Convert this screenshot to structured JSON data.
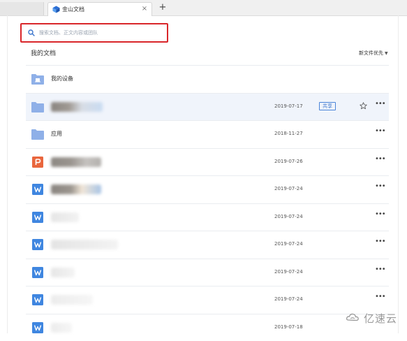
{
  "browser": {
    "tab_title": "金山文档",
    "close_glyph": "×",
    "new_tab_glyph": "+"
  },
  "search": {
    "placeholder": "搜索文档、正文内容或团队",
    "value": "",
    "icon": "search-icon"
  },
  "section": {
    "title": "我的文档",
    "sort_label": "新文件优先",
    "sort_caret": "▼"
  },
  "rows": [
    {
      "type": "device-folder",
      "name": "我的设备",
      "date": "",
      "shared": false,
      "star": false,
      "more": false
    },
    {
      "type": "folder",
      "name": "",
      "date": "2019-07-17",
      "shared": true,
      "share_label": "共享",
      "star": true,
      "more": true
    },
    {
      "type": "folder",
      "name": "应用",
      "date": "2018-11-27",
      "shared": false,
      "star": false,
      "more": true
    },
    {
      "type": "ppt",
      "name": "",
      "date": "2019-07-26",
      "shared": false,
      "star": false,
      "more": true
    },
    {
      "type": "word",
      "name": "",
      "date": "2019-07-24",
      "shared": false,
      "star": false,
      "more": true
    },
    {
      "type": "word",
      "name": "",
      "date": "2019-07-24",
      "shared": false,
      "star": false,
      "more": true
    },
    {
      "type": "word",
      "name": "",
      "date": "2019-07-24",
      "shared": false,
      "star": false,
      "more": true
    },
    {
      "type": "word",
      "name": "",
      "date": "2019-07-24",
      "shared": false,
      "star": false,
      "more": true
    },
    {
      "type": "word",
      "name": "",
      "date": "2019-07-24",
      "shared": false,
      "star": false,
      "more": true
    },
    {
      "type": "word",
      "name": "",
      "date": "2019-07-18",
      "shared": false,
      "star": false,
      "more": false
    }
  ],
  "more_glyph": "•••",
  "watermark": "亿速云",
  "colors": {
    "folder": "#8fb0e8",
    "ppt": "#e9663d",
    "word": "#3f86e0",
    "share": "#4a84d9",
    "highlight": "#d9262a"
  }
}
